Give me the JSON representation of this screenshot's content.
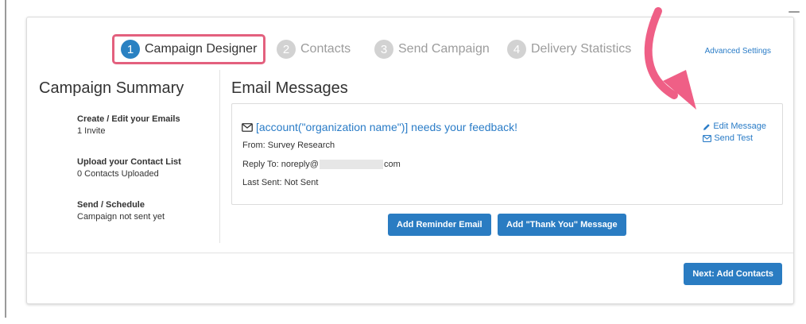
{
  "steps": [
    {
      "number": "1",
      "label": "Campaign Designer",
      "active": true
    },
    {
      "number": "2",
      "label": "Contacts",
      "active": false
    },
    {
      "number": "3",
      "label": "Send Campaign",
      "active": false
    },
    {
      "number": "4",
      "label": "Delivery Statistics",
      "active": false
    }
  ],
  "advanced_settings": "Advanced Settings",
  "sidebar": {
    "title": "Campaign Summary",
    "items": [
      {
        "title": "Create / Edit your Emails",
        "subtitle": "1 Invite"
      },
      {
        "title": "Upload your Contact List",
        "subtitle": "0 Contacts Uploaded"
      },
      {
        "title": "Send / Schedule",
        "subtitle": "Campaign not sent yet"
      }
    ]
  },
  "main": {
    "title": "Email Messages",
    "message": {
      "subject": "[account(\"organization name\")] needs your feedback!",
      "from": "From: Survey Research",
      "reply_to_prefix": "Reply To: noreply@",
      "reply_to_suffix": "com",
      "last_sent": "Last Sent: Not Sent",
      "edit_label": "Edit Message",
      "test_label": "Send Test"
    },
    "add_reminder_label": "Add Reminder Email",
    "add_thankyou_label": "Add \"Thank You\" Message"
  },
  "footer": {
    "next_label": "Next: Add Contacts"
  },
  "colors": {
    "accent": "#2a7cc2",
    "highlight": "#e3607e",
    "arrow": "#ef5f86"
  },
  "icons": [
    "envelope-icon",
    "pencil-icon",
    "envelope-icon",
    "pink-arrow"
  ]
}
